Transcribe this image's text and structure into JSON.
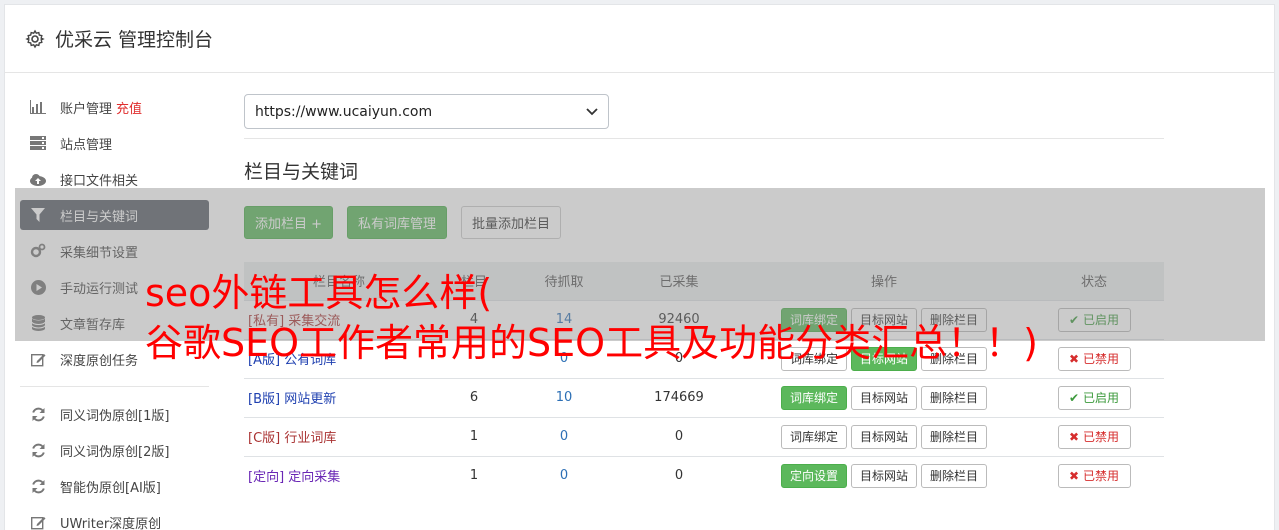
{
  "header": {
    "title": "优采云 管理控制台",
    "icon": "gear-icon"
  },
  "sidebar": {
    "items": [
      {
        "label": "账户管理",
        "extra": "充值",
        "icon": "bar-chart-icon"
      },
      {
        "label": "站点管理",
        "icon": "server-icon"
      },
      {
        "label": "接口文件相关",
        "icon": "cloud-upload-icon"
      },
      {
        "label": "栏目与关键词",
        "icon": "filter-icon",
        "active": true
      },
      {
        "label": "采集细节设置",
        "icon": "cogs-icon"
      },
      {
        "label": "手动运行测试",
        "icon": "play-circle-icon"
      },
      {
        "label": "文章暂存库",
        "icon": "database-icon"
      },
      {
        "label": "深度原创任务",
        "icon": "edit-icon"
      }
    ],
    "items2": [
      {
        "label": "同义词伪原创[1版]",
        "icon": "refresh-icon"
      },
      {
        "label": "同义词伪原创[2版]",
        "icon": "refresh-icon"
      },
      {
        "label": "智能伪原创[AI版]",
        "icon": "refresh-icon"
      },
      {
        "label": "UWriter深度原创",
        "icon": "edit-icon"
      }
    ]
  },
  "main": {
    "site_select": "https://www.ucaiyun.com",
    "section_title": "栏目与关键词",
    "buttons": {
      "add_column": "添加栏目 +",
      "private_lib": "私有词库管理",
      "batch_add": "批量添加栏目"
    },
    "table": {
      "headers": [
        "栏目名称",
        "栏目",
        "待抓取",
        "已采集",
        "操作",
        "状态"
      ],
      "rows": [
        {
          "tag": "[私有]",
          "name": "采集交流",
          "count": "4",
          "pending": "14",
          "collected": "92460",
          "op1": "词库绑定",
          "op1_green": true,
          "op2": "目标网站",
          "op3": "删除栏目",
          "status": "已启用",
          "on": true
        },
        {
          "tag": "[A版]",
          "name": "公有词库",
          "count": "",
          "pending": "0",
          "collected": "0",
          "op1": "词库绑定",
          "op1_green": false,
          "op2": "目标网站",
          "op3": "删除栏目",
          "status": "已禁用",
          "on": false
        },
        {
          "tag": "[B版]",
          "name": "网站更新",
          "count": "6",
          "pending": "10",
          "collected": "174669",
          "op1": "词库绑定",
          "op1_green": true,
          "op2": "目标网站",
          "op3": "删除栏目",
          "status": "已启用",
          "on": true
        },
        {
          "tag": "[C版]",
          "name": "行业词库",
          "count": "1",
          "pending": "0",
          "collected": "0",
          "op1": "词库绑定",
          "op1_green": false,
          "op2": "目标网站",
          "op3": "删除栏目",
          "status": "已禁用",
          "on": false
        },
        {
          "tag": "[定向]",
          "name": "定向采集",
          "count": "1",
          "pending": "0",
          "collected": "0",
          "op1": "定向设置",
          "op1_green": true,
          "op2": "目标网站",
          "op3": "删除栏目",
          "status": "已禁用",
          "on": false
        }
      ]
    }
  },
  "overlay": {
    "line1": "seo外链工具怎么样(",
    "line2": "谷歌SEO工作者常用的SEO工具及功能分类汇总！！)"
  }
}
